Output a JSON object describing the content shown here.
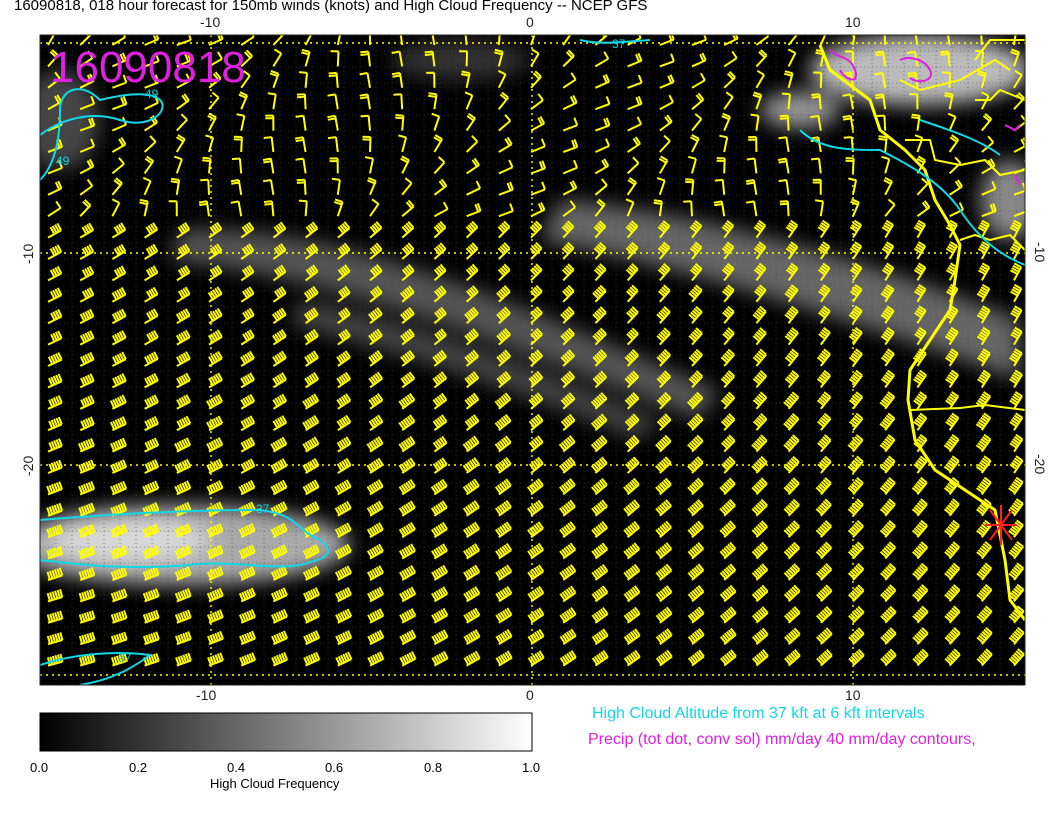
{
  "title": "16090818, 018 hour forecast for 150mb winds (knots) and High Cloud Frequency -- NCEP GFS",
  "stamp": "16090818",
  "axes": {
    "x_ticks": [
      "-10",
      "0",
      "10"
    ],
    "y_ticks": [
      "-10",
      "-20"
    ]
  },
  "contour_labels": [
    "49",
    "49",
    "37",
    "37",
    "37"
  ],
  "legend": {
    "cloud_altitude": "High Cloud Altitude from 37 kft at 6 kft intervals",
    "precip": "Precip (tot dot, conv sol) mm/day 40 mm/day contours,"
  },
  "colorbar": {
    "title": "High Cloud Frequency",
    "ticks": [
      "0.0",
      "0.2",
      "0.4",
      "0.6",
      "0.8",
      "1.0"
    ]
  },
  "colors": {
    "background": "#000000",
    "barbs": "#ffff00",
    "coast": "#ffff00",
    "cloud_contour": "#10d8e8",
    "precip_contour": "#e020e0",
    "stamp": "#e020e0",
    "marker": "#ff2020"
  },
  "icons": {
    "location_marker": "asterisk-marker-icon"
  }
}
